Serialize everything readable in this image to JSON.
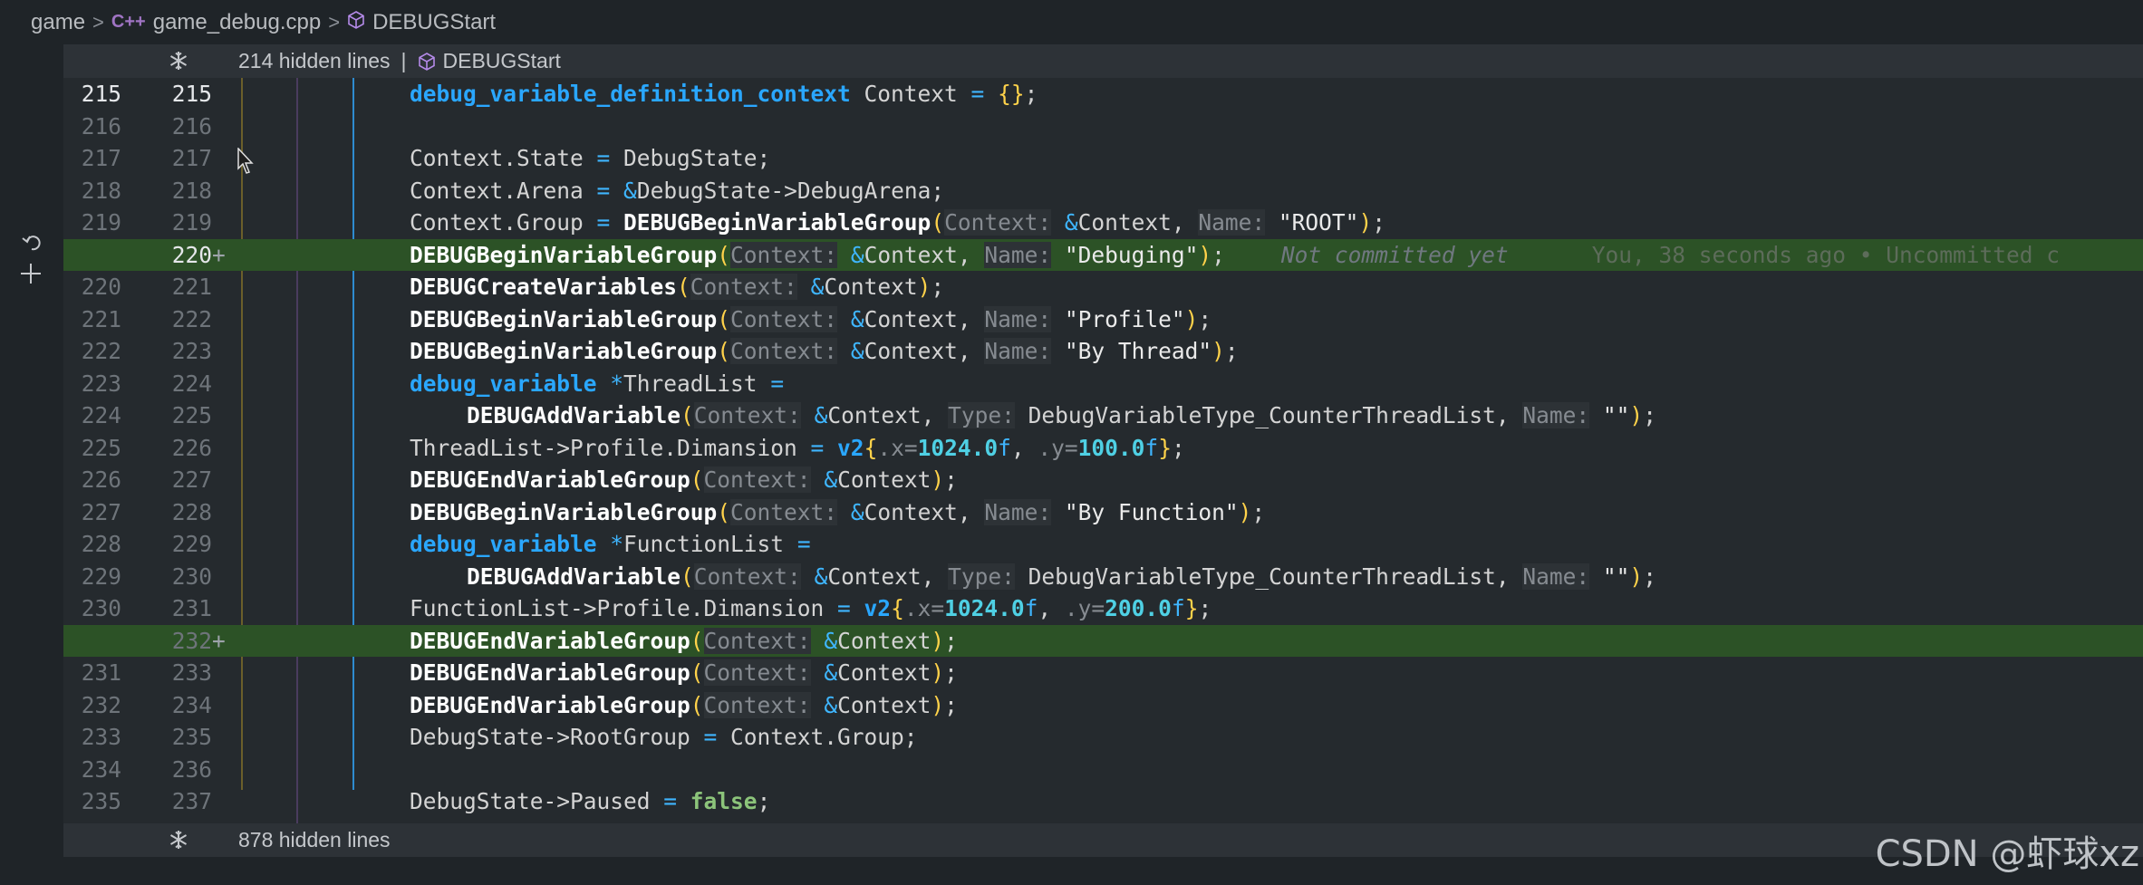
{
  "breadcrumb": {
    "folder": "game",
    "file_icon": "C++",
    "file": "game_debug.cpp",
    "symbol": "DEBUGStart"
  },
  "fold_top": {
    "text": "214 hidden lines",
    "separator": "|",
    "symbol": "DEBUGStart"
  },
  "fold_bottom": {
    "text": "878 hidden lines"
  },
  "blame": {
    "status": "Not committed yet",
    "author_info": "You, 38 seconds ago • Uncommitted c"
  },
  "lines": [
    {
      "old": "215",
      "new": "215",
      "added": false,
      "current": true,
      "indent": 1,
      "tokens": [
        [
          "type",
          "debug_variable_definition_context"
        ],
        [
          "punc",
          " Context "
        ],
        [
          "op",
          "="
        ],
        [
          "punc",
          " "
        ],
        [
          "brace",
          "{}"
        ],
        [
          "punc",
          ";"
        ]
      ]
    },
    {
      "old": "216",
      "new": "216",
      "added": false,
      "indent": 1,
      "tokens": []
    },
    {
      "old": "217",
      "new": "217",
      "added": false,
      "indent": 1,
      "tokens": [
        [
          "punc",
          "Context.State "
        ],
        [
          "op",
          "="
        ],
        [
          "punc",
          " DebugState;"
        ]
      ]
    },
    {
      "old": "218",
      "new": "218",
      "added": false,
      "indent": 1,
      "tokens": [
        [
          "punc",
          "Context.Arena "
        ],
        [
          "op",
          "="
        ],
        [
          "punc",
          " "
        ],
        [
          "op",
          "&"
        ],
        [
          "punc",
          "DebugState->DebugArena;"
        ]
      ]
    },
    {
      "old": "219",
      "new": "219",
      "added": false,
      "indent": 1,
      "tokens": [
        [
          "punc",
          "Context.Group "
        ],
        [
          "op",
          "="
        ],
        [
          "punc",
          " "
        ],
        [
          "func",
          "DEBUGBeginVariableGroup"
        ],
        [
          "brace",
          "("
        ],
        [
          "param",
          "Context:"
        ],
        [
          "punc",
          " "
        ],
        [
          "op",
          "&"
        ],
        [
          "punc",
          "Context, "
        ],
        [
          "param",
          "Name:"
        ],
        [
          "punc",
          " "
        ],
        [
          "str",
          "\"ROOT\""
        ],
        [
          "brace",
          ")"
        ],
        [
          "punc",
          ";"
        ]
      ]
    },
    {
      "old": "",
      "new": "220",
      "added": true,
      "current": true,
      "indent": 1,
      "blame": true,
      "tokens": [
        [
          "func",
          "DEBUGBeginVariableGroup"
        ],
        [
          "brace",
          "("
        ],
        [
          "param",
          "Context:"
        ],
        [
          "punc",
          " "
        ],
        [
          "op",
          "&"
        ],
        [
          "punc",
          "Context, "
        ],
        [
          "param",
          "Name:"
        ],
        [
          "punc",
          " "
        ],
        [
          "str",
          "\"Debuging\""
        ],
        [
          "brace",
          ")"
        ],
        [
          "punc",
          ";"
        ]
      ]
    },
    {
      "old": "220",
      "new": "221",
      "added": false,
      "indent": 1,
      "tokens": [
        [
          "func",
          "DEBUGCreateVariables"
        ],
        [
          "brace",
          "("
        ],
        [
          "param",
          "Context:"
        ],
        [
          "punc",
          " "
        ],
        [
          "op",
          "&"
        ],
        [
          "punc",
          "Context"
        ],
        [
          "brace",
          ")"
        ],
        [
          "punc",
          ";"
        ]
      ]
    },
    {
      "old": "221",
      "new": "222",
      "added": false,
      "indent": 1,
      "tokens": [
        [
          "func",
          "DEBUGBeginVariableGroup"
        ],
        [
          "brace",
          "("
        ],
        [
          "param",
          "Context:"
        ],
        [
          "punc",
          " "
        ],
        [
          "op",
          "&"
        ],
        [
          "punc",
          "Context, "
        ],
        [
          "param",
          "Name:"
        ],
        [
          "punc",
          " "
        ],
        [
          "str",
          "\"Profile\""
        ],
        [
          "brace",
          ")"
        ],
        [
          "punc",
          ";"
        ]
      ]
    },
    {
      "old": "222",
      "new": "223",
      "added": false,
      "indent": 1,
      "tokens": [
        [
          "func",
          "DEBUGBeginVariableGroup"
        ],
        [
          "brace",
          "("
        ],
        [
          "param",
          "Context:"
        ],
        [
          "punc",
          " "
        ],
        [
          "op",
          "&"
        ],
        [
          "punc",
          "Context, "
        ],
        [
          "param",
          "Name:"
        ],
        [
          "punc",
          " "
        ],
        [
          "str",
          "\"By Thread\""
        ],
        [
          "brace",
          ")"
        ],
        [
          "punc",
          ";"
        ]
      ]
    },
    {
      "old": "223",
      "new": "224",
      "added": false,
      "indent": 1,
      "tokens": [
        [
          "type",
          "debug_variable"
        ],
        [
          "punc",
          " "
        ],
        [
          "op",
          "*"
        ],
        [
          "punc",
          "ThreadList "
        ],
        [
          "op",
          "="
        ]
      ]
    },
    {
      "old": "224",
      "new": "225",
      "added": false,
      "indent": 2,
      "tokens": [
        [
          "func",
          "DEBUGAddVariable"
        ],
        [
          "brace",
          "("
        ],
        [
          "param",
          "Context:"
        ],
        [
          "punc",
          " "
        ],
        [
          "op",
          "&"
        ],
        [
          "punc",
          "Context, "
        ],
        [
          "param",
          "Type:"
        ],
        [
          "punc",
          " DebugVariableType_CounterThreadList, "
        ],
        [
          "param",
          "Name:"
        ],
        [
          "punc",
          " "
        ],
        [
          "str",
          "\"\""
        ],
        [
          "brace",
          ")"
        ],
        [
          "punc",
          ";"
        ]
      ]
    },
    {
      "old": "225",
      "new": "226",
      "added": false,
      "indent": 1,
      "tokens": [
        [
          "punc",
          "ThreadList->Profile.Dimansion "
        ],
        [
          "op",
          "="
        ],
        [
          "punc",
          " "
        ],
        [
          "type",
          "v2"
        ],
        [
          "brace",
          "{"
        ],
        [
          "dim",
          ".x="
        ],
        [
          "num",
          "1024.0"
        ],
        [
          "op",
          "f"
        ],
        [
          "punc",
          ", "
        ],
        [
          "dim",
          ".y="
        ],
        [
          "num",
          "100.0"
        ],
        [
          "op",
          "f"
        ],
        [
          "brace",
          "}"
        ],
        [
          "punc",
          ";"
        ]
      ]
    },
    {
      "old": "226",
      "new": "227",
      "added": false,
      "indent": 1,
      "tokens": [
        [
          "func",
          "DEBUGEndVariableGroup"
        ],
        [
          "brace",
          "("
        ],
        [
          "param",
          "Context:"
        ],
        [
          "punc",
          " "
        ],
        [
          "op",
          "&"
        ],
        [
          "punc",
          "Context"
        ],
        [
          "brace",
          ")"
        ],
        [
          "punc",
          ";"
        ]
      ]
    },
    {
      "old": "227",
      "new": "228",
      "added": false,
      "indent": 1,
      "tokens": [
        [
          "func",
          "DEBUGBeginVariableGroup"
        ],
        [
          "brace",
          "("
        ],
        [
          "param",
          "Context:"
        ],
        [
          "punc",
          " "
        ],
        [
          "op",
          "&"
        ],
        [
          "punc",
          "Context, "
        ],
        [
          "param",
          "Name:"
        ],
        [
          "punc",
          " "
        ],
        [
          "str",
          "\"By Function\""
        ],
        [
          "brace",
          ")"
        ],
        [
          "punc",
          ";"
        ]
      ]
    },
    {
      "old": "228",
      "new": "229",
      "added": false,
      "indent": 1,
      "tokens": [
        [
          "type",
          "debug_variable"
        ],
        [
          "punc",
          " "
        ],
        [
          "op",
          "*"
        ],
        [
          "punc",
          "FunctionList "
        ],
        [
          "op",
          "="
        ]
      ]
    },
    {
      "old": "229",
      "new": "230",
      "added": false,
      "indent": 2,
      "tokens": [
        [
          "func",
          "DEBUGAddVariable"
        ],
        [
          "brace",
          "("
        ],
        [
          "param",
          "Context:"
        ],
        [
          "punc",
          " "
        ],
        [
          "op",
          "&"
        ],
        [
          "punc",
          "Context, "
        ],
        [
          "param",
          "Type:"
        ],
        [
          "punc",
          " DebugVariableType_CounterThreadList, "
        ],
        [
          "param",
          "Name:"
        ],
        [
          "punc",
          " "
        ],
        [
          "str",
          "\"\""
        ],
        [
          "brace",
          ")"
        ],
        [
          "punc",
          ";"
        ]
      ]
    },
    {
      "old": "230",
      "new": "231",
      "added": false,
      "indent": 1,
      "tokens": [
        [
          "punc",
          "FunctionList->Profile.Dimansion "
        ],
        [
          "op",
          "="
        ],
        [
          "punc",
          " "
        ],
        [
          "type",
          "v2"
        ],
        [
          "brace",
          "{"
        ],
        [
          "dim",
          ".x="
        ],
        [
          "num",
          "1024.0"
        ],
        [
          "op",
          "f"
        ],
        [
          "punc",
          ", "
        ],
        [
          "dim",
          ".y="
        ],
        [
          "num",
          "200.0"
        ],
        [
          "op",
          "f"
        ],
        [
          "brace",
          "}"
        ],
        [
          "punc",
          ";"
        ]
      ]
    },
    {
      "old": "",
      "new": "232",
      "added": true,
      "indent": 1,
      "tokens": [
        [
          "func",
          "DEBUGEndVariableGroup"
        ],
        [
          "brace",
          "("
        ],
        [
          "param",
          "Context:"
        ],
        [
          "punc",
          " "
        ],
        [
          "op",
          "&"
        ],
        [
          "punc",
          "Context"
        ],
        [
          "brace",
          ")"
        ],
        [
          "punc",
          ";"
        ]
      ]
    },
    {
      "old": "231",
      "new": "233",
      "added": false,
      "indent": 1,
      "tokens": [
        [
          "func",
          "DEBUGEndVariableGroup"
        ],
        [
          "brace",
          "("
        ],
        [
          "param",
          "Context:"
        ],
        [
          "punc",
          " "
        ],
        [
          "op",
          "&"
        ],
        [
          "punc",
          "Context"
        ],
        [
          "brace",
          ")"
        ],
        [
          "punc",
          ";"
        ]
      ]
    },
    {
      "old": "232",
      "new": "234",
      "added": false,
      "indent": 1,
      "tokens": [
        [
          "func",
          "DEBUGEndVariableGroup"
        ],
        [
          "brace",
          "("
        ],
        [
          "param",
          "Context:"
        ],
        [
          "punc",
          " "
        ],
        [
          "op",
          "&"
        ],
        [
          "punc",
          "Context"
        ],
        [
          "brace",
          ")"
        ],
        [
          "punc",
          ";"
        ]
      ]
    },
    {
      "old": "233",
      "new": "235",
      "added": false,
      "indent": 1,
      "tokens": [
        [
          "punc",
          "DebugState->RootGroup "
        ],
        [
          "op",
          "="
        ],
        [
          "punc",
          " Context.Group;"
        ]
      ]
    },
    {
      "old": "234",
      "new": "236",
      "added": false,
      "indent": 1,
      "tokens": []
    },
    {
      "old": "235",
      "new": "237",
      "added": false,
      "indent": 1,
      "tokens": [
        [
          "punc",
          "DebugState->Paused "
        ],
        [
          "op",
          "="
        ],
        [
          "punc",
          " "
        ],
        [
          "bool",
          "false"
        ],
        [
          "punc",
          ";"
        ]
      ]
    }
  ],
  "diff_marker": "+",
  "watermark": "CSDN @虾球xz",
  "colors": {
    "added_line": "#2c5226",
    "type": "#2aa7ff",
    "number": "#4fd0e4",
    "brace": "#ffd24a"
  }
}
